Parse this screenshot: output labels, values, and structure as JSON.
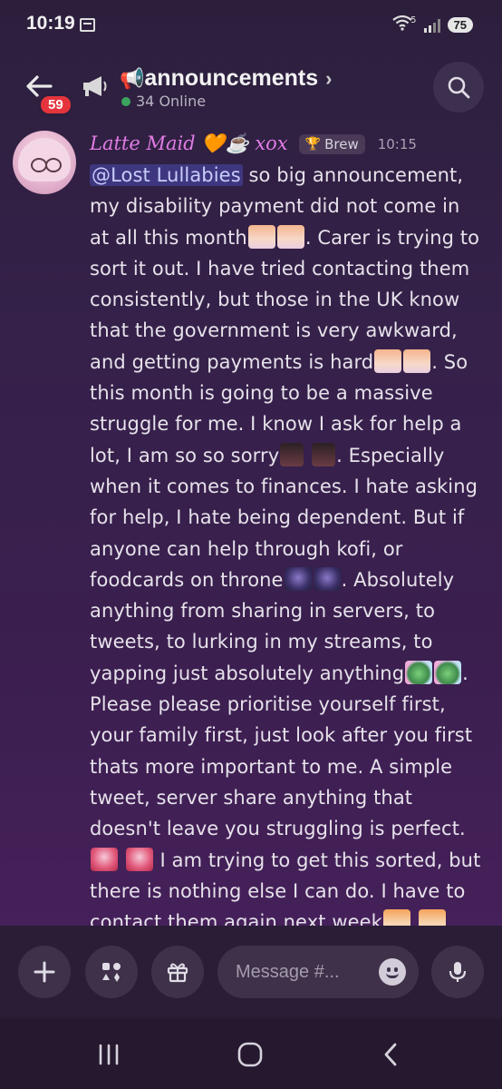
{
  "status_bar": {
    "time": "10:19",
    "wifi_label": "5",
    "battery": "75"
  },
  "header": {
    "back_badge": "59",
    "channel_emoji": "📢",
    "channel_name": "announcements",
    "chevron": "›",
    "online_text": "34 Online",
    "accent_online": "#3ba55d"
  },
  "message": {
    "author_name": "Latte Maid",
    "author_emojis": "🧡☕",
    "author_suffix": "xox",
    "tag": "Brew",
    "time": "10:15",
    "author_color": "#e07ce4",
    "mention": "@Lost Lullabies",
    "segments": {
      "s1": " so big announcement, my disability payment did not come in at all this month",
      "s2": ". Carer is trying to sort it out. I have tried contacting them consistently, but those in the UK know that the government is very awkward, and getting payments is hard",
      "s3": ". So this month is going to be a massive struggle for me. I know I ask for help a lot, I am so so sorry",
      "s4": ". Especially when it comes to finances. I hate asking for help, I hate being dependent. But if anyone can help through kofi, or foodcards on throne",
      "s5": ". Absolutely anything from sharing in servers, to tweets, to lurking in my streams, to yapping just absolutely anything",
      "s6": ". Please please prioritise yourself first, your family first, just look after you first thats more important to me. A simple tweet, server share anything that doesn't leave you struggling is perfect.",
      "s7": " I am trying to get this sorted, but there is nothing else I can do. I have to contact them again next week"
    },
    "custom_emojis": [
      "crying-girl-emoji",
      "crying-girl-emoji",
      "crying-girl-emoji",
      "crying-girl-emoji",
      "boot-emoji",
      "boot-emoji",
      "dark-face-emoji",
      "dark-face-emoji",
      "ghost-emoji",
      "ghost-emoji",
      "heart-girl-emoji",
      "heart-girl-emoji",
      "orange-hair-emoji",
      "orange-hair-emoji"
    ]
  },
  "composer": {
    "placeholder": "Message #...",
    "buttons": [
      "plus-icon",
      "apps-icon",
      "gift-icon",
      "emoji-icon",
      "mic-icon"
    ]
  },
  "navbar": {
    "items": [
      "recent-apps",
      "home",
      "back"
    ]
  }
}
